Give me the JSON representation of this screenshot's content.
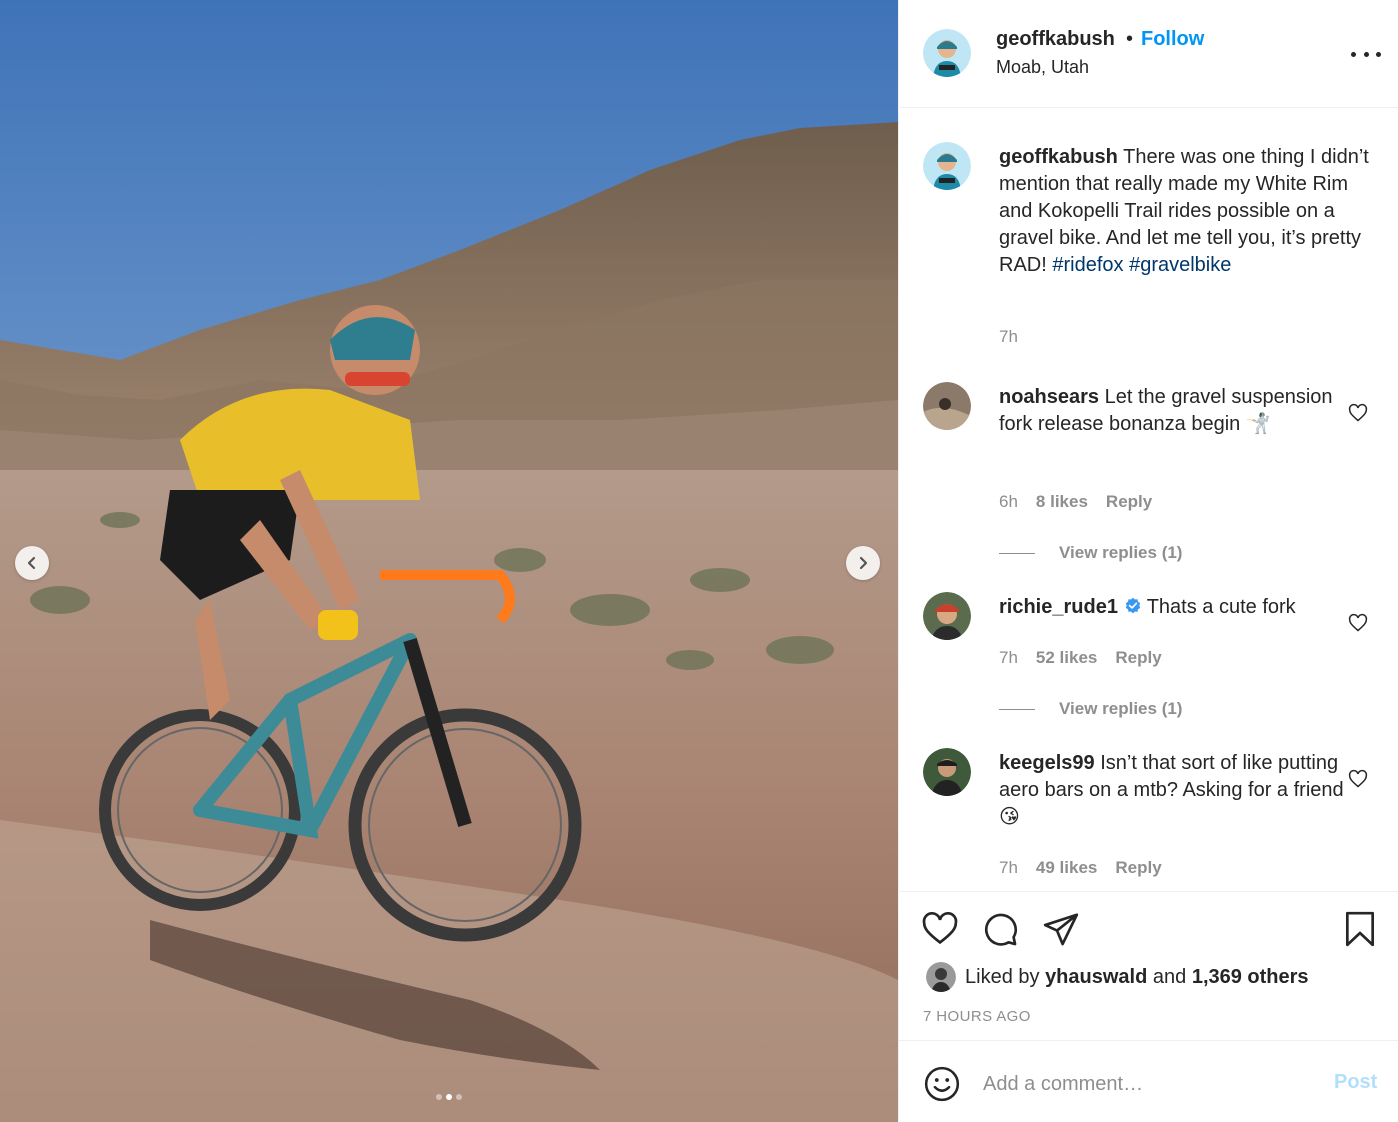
{
  "post": {
    "image_alt": "Cyclist on a teal gravel bike riding a dirt road in the desert",
    "carousel": {
      "total": 3,
      "active": 2
    }
  },
  "header": {
    "username": "geoffkabush",
    "separator": "•",
    "follow_label": "Follow",
    "location": "Moab, Utah"
  },
  "caption": {
    "username": "geoffkabush",
    "text": "There was one thing I didn’t mention that really made my White Rim and Kokopelli Trail rides possible on a gravel bike. And let me tell you, it’s pretty RAD!",
    "hashtags": [
      "#ridefox",
      "#gravelbike"
    ],
    "time": "7h"
  },
  "comments": [
    {
      "username": "noahsears",
      "text": "Let the gravel suspension fork release bonanza begin 🤺",
      "time": "6h",
      "likes": "8 likes",
      "reply_label": "Reply",
      "view_replies": "View replies (1)"
    },
    {
      "username": "richie_rude1",
      "verified": true,
      "text": "Thats a cute fork",
      "time": "7h",
      "likes": "52 likes",
      "reply_label": "Reply",
      "view_replies": "View replies (1)"
    },
    {
      "username": "keegels99",
      "text": "Isn’t that sort of like putting aero bars on a mtb? Asking for a friend 😘",
      "time": "7h",
      "likes": "49 likes",
      "reply_label": "Reply"
    }
  ],
  "actions": {
    "icons": [
      "heart-icon",
      "comment-icon",
      "share-icon",
      "bookmark-icon"
    ],
    "liked_by_prefix": "Liked by",
    "liked_by_user": "yhauswald",
    "liked_by_and": "and",
    "liked_by_count": "1,369 others",
    "time_ago": "7 HOURS AGO"
  },
  "add_comment": {
    "placeholder": "Add a comment…",
    "post_label": "Post"
  },
  "colors": {
    "accent": "#0095f6",
    "hashtag": "#00376b",
    "muted": "#8e8e8e",
    "post_disabled": "#b2dffc",
    "verified": "#3897f0"
  }
}
